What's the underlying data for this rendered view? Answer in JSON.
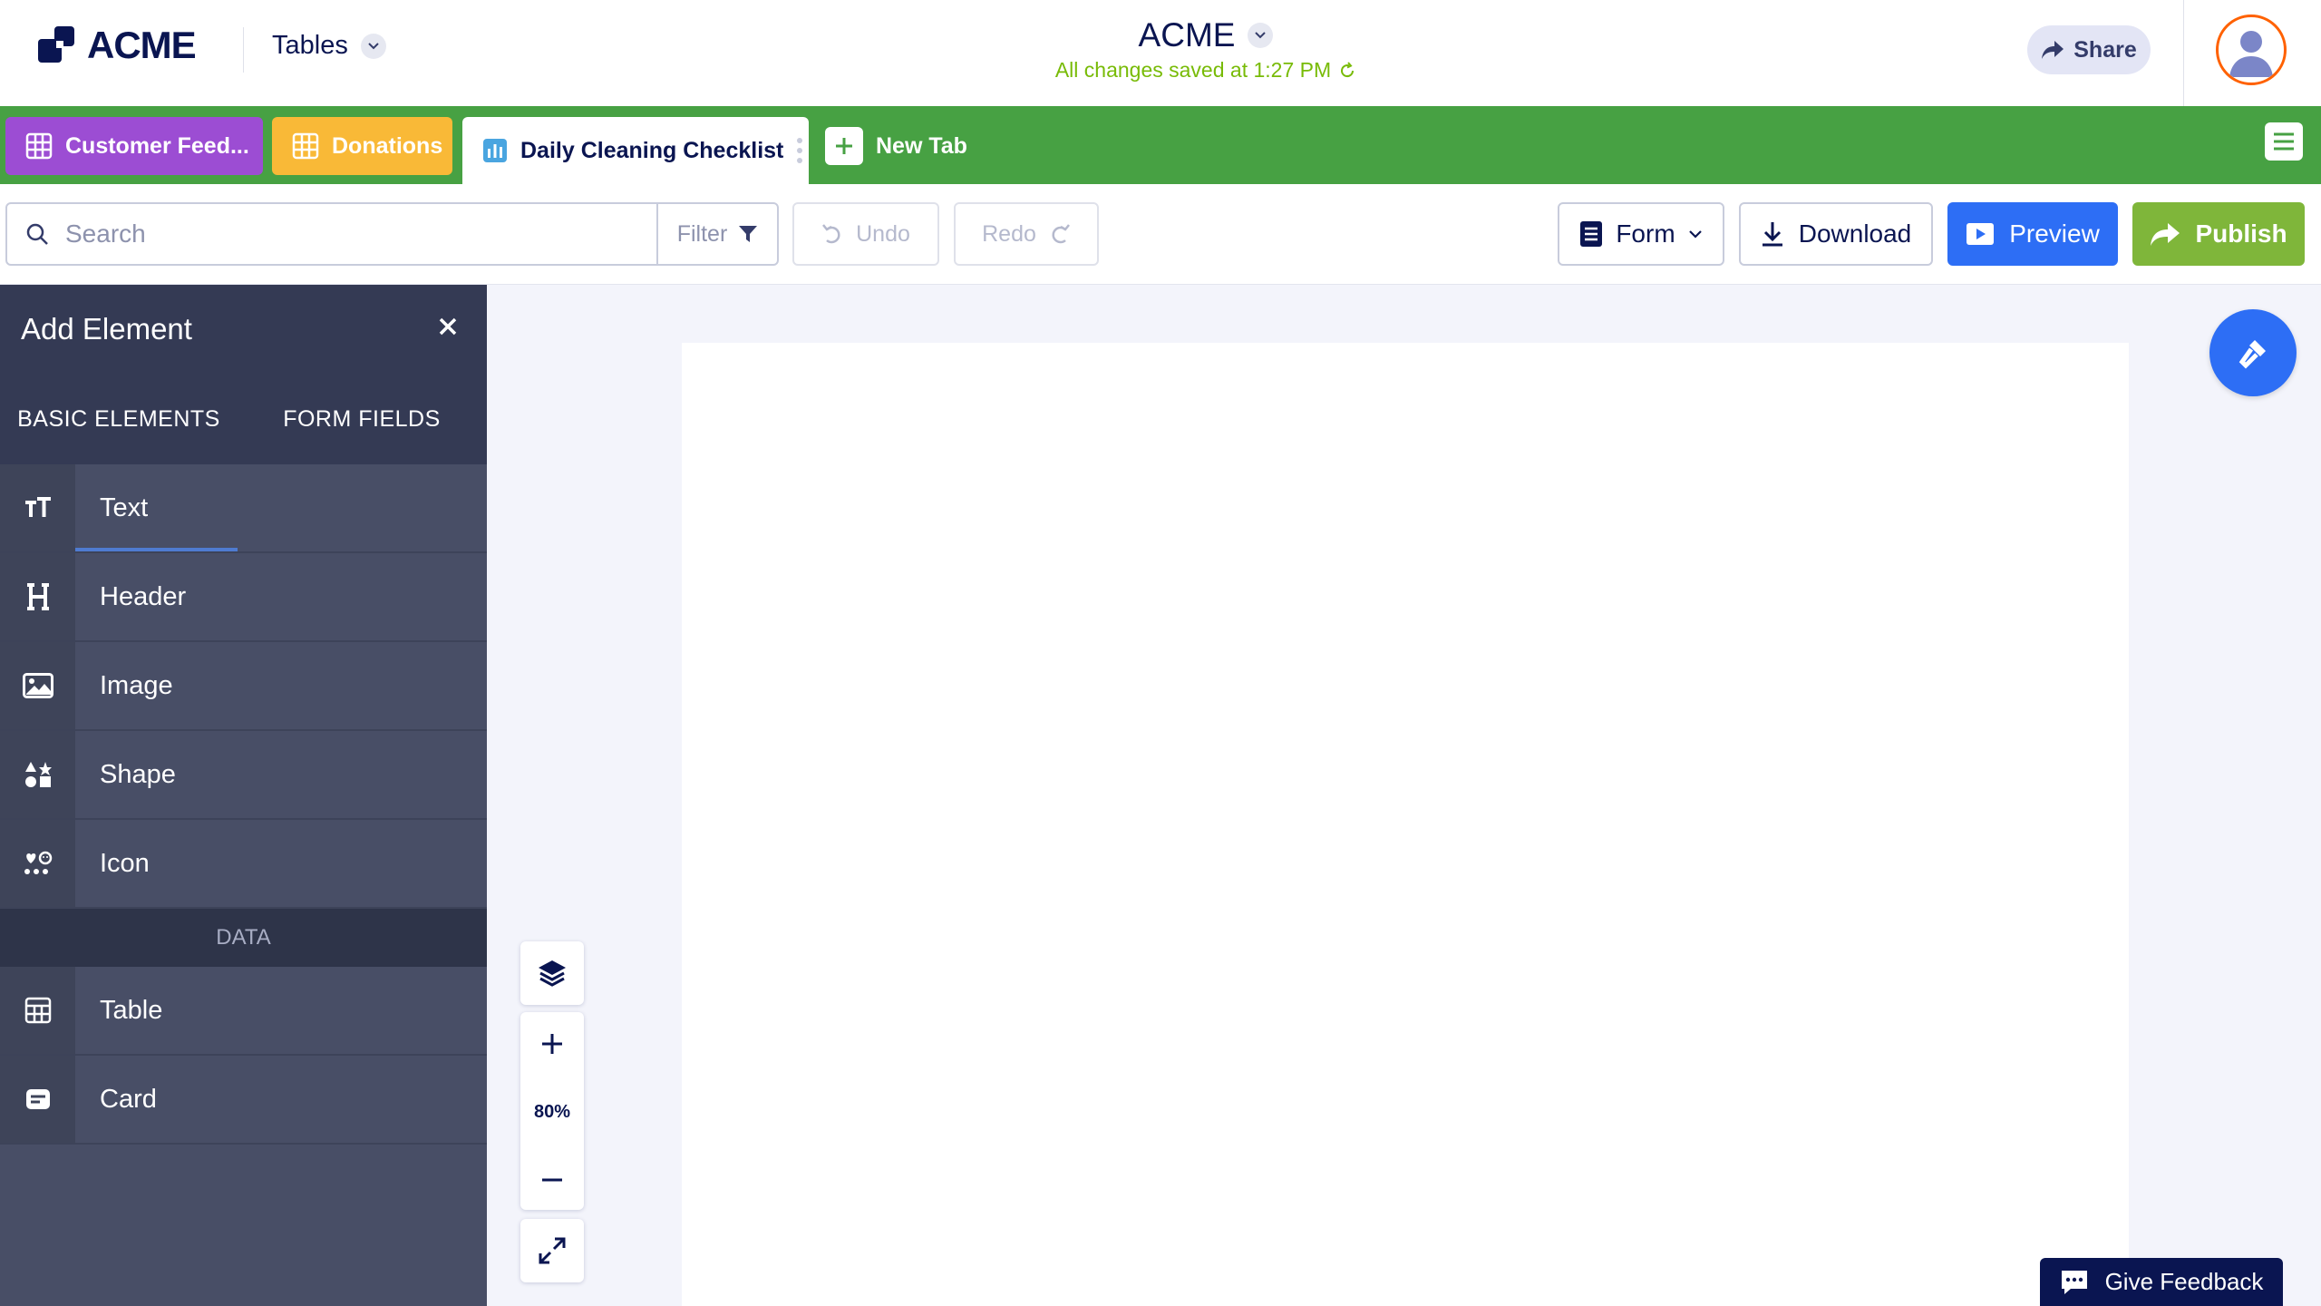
{
  "header": {
    "logo_text": "ACME",
    "app_switcher_label": "Tables",
    "workspace_title": "ACME",
    "save_status": "All changes saved at 1:27 PM",
    "share_label": "Share"
  },
  "tabs": [
    {
      "label": "Customer Feed...",
      "color": "#9c4dd3",
      "icon": "table-icon"
    },
    {
      "label": "Donations",
      "color": "#f9b937",
      "icon": "table-icon"
    },
    {
      "label": "Daily Cleaning Checklist",
      "color": "#ffffff",
      "icon": "report-icon",
      "active": true
    }
  ],
  "new_tab_label": "New Tab",
  "toolbar": {
    "search_placeholder": "Search",
    "filter_label": "Filter",
    "undo_label": "Undo",
    "redo_label": "Redo",
    "form_label": "Form",
    "download_label": "Download",
    "preview_label": "Preview",
    "publish_label": "Publish"
  },
  "sidebar": {
    "title": "Add Element",
    "tabs": [
      "BASIC ELEMENTS",
      "FORM FIELDS"
    ],
    "basic_elements": [
      {
        "label": "Text",
        "icon": "text-size-icon"
      },
      {
        "label": "Header",
        "icon": "header-icon"
      },
      {
        "label": "Image",
        "icon": "image-icon"
      },
      {
        "label": "Shape",
        "icon": "shapes-icon"
      },
      {
        "label": "Icon",
        "icon": "icons-icon"
      }
    ],
    "data_section_label": "DATA",
    "data_elements": [
      {
        "label": "Table",
        "icon": "table-icon"
      },
      {
        "label": "Card",
        "icon": "card-icon"
      }
    ]
  },
  "canvas": {
    "zoom_level": "80%"
  },
  "feedback_label": "Give Feedback",
  "colors": {
    "navy": "#0a1551",
    "tabbar_green": "#47a143",
    "preview_blue": "#2d6ef5",
    "publish_green": "#7fb63a",
    "saved_green": "#78bb07",
    "sidebar_bg": "#484e66"
  }
}
